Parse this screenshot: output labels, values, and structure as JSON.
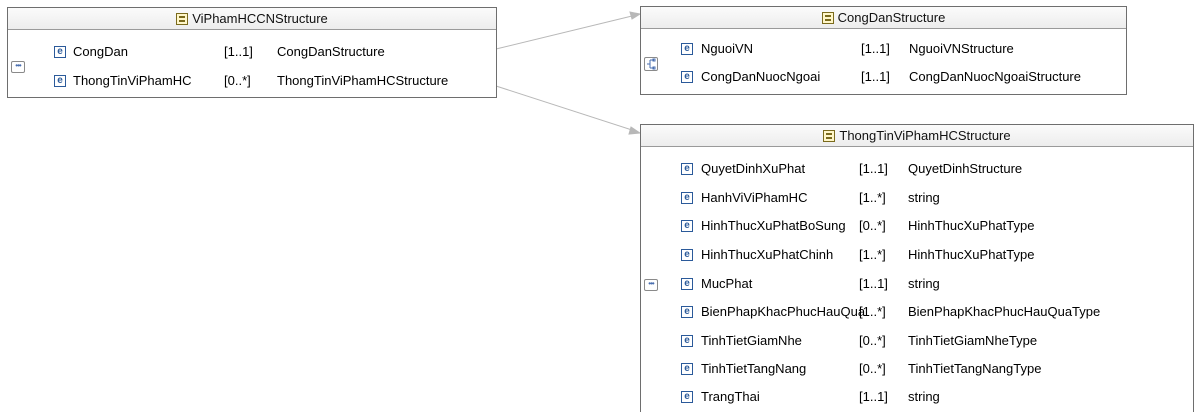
{
  "boxes": {
    "vipham": {
      "title": "ViPhamHCCNStructure",
      "rows": [
        {
          "name": "CongDan",
          "card": "[1..1]",
          "type": "CongDanStructure"
        },
        {
          "name": "ThongTinViPhamHC",
          "card": "[0..*]",
          "type": "ThongTinViPhamHCStructure"
        }
      ]
    },
    "congdan": {
      "title": "CongDanStructure",
      "rows": [
        {
          "name": "NguoiVN",
          "card": "[1..1]",
          "type": "NguoiVNStructure"
        },
        {
          "name": "CongDanNuocNgoai",
          "card": "[1..1]",
          "type": "CongDanNuocNgoaiStructure"
        }
      ]
    },
    "thongtin": {
      "title": "ThongTinViPhamHCStructure",
      "rows": [
        {
          "name": "QuyetDinhXuPhat",
          "card": "[1..1]",
          "type": "QuyetDinhStructure"
        },
        {
          "name": "HanhViViPhamHC",
          "card": "[1..*]",
          "type": "string"
        },
        {
          "name": "HinhThucXuPhatBoSung",
          "card": "[0..*]",
          "type": "HinhThucXuPhatType"
        },
        {
          "name": "HinhThucXuPhatChinh",
          "card": "[1..*]",
          "type": "HinhThucXuPhatType"
        },
        {
          "name": "MucPhat",
          "card": "[1..1]",
          "type": "string"
        },
        {
          "name": "BienPhapKhacPhucHauQua",
          "card": "[1..*]",
          "type": "BienPhapKhacPhucHauQuaType"
        },
        {
          "name": "TinhTietGiamNhe",
          "card": "[0..*]",
          "type": "TinhTietGiamNheType"
        },
        {
          "name": "TinhTietTangNang",
          "card": "[0..*]",
          "type": "TinhTietTangNangType"
        },
        {
          "name": "TrangThai",
          "card": "[1..1]",
          "type": "string"
        }
      ]
    }
  },
  "icons": {
    "element_glyph": "e",
    "sequence_glyph": "•••",
    "colors": {
      "element_border": "#2b5a9a",
      "type_icon": "#7a6a1c",
      "connector": "#b0b0b0"
    }
  }
}
